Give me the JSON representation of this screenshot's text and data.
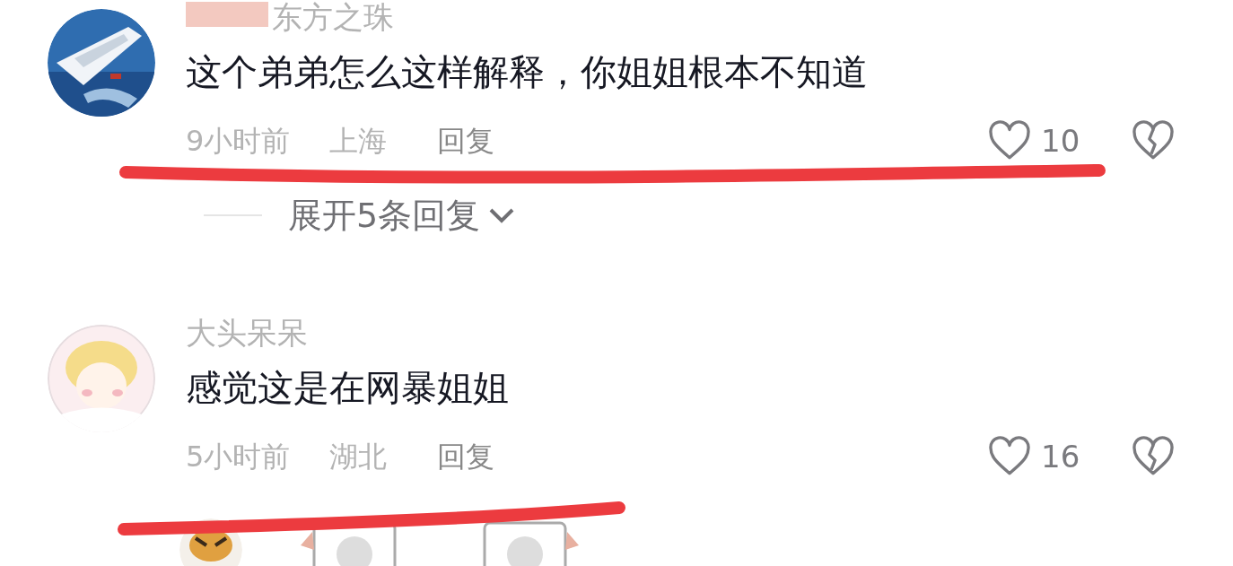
{
  "comments": [
    {
      "user": "东方之珠",
      "user_prefix_redacted": true,
      "text": "这个弟弟怎么这样解释，你姐姐根本不知道",
      "time": "9小时前",
      "region": "上海",
      "reply": "回复",
      "likes": "10",
      "expand": "展开5条回复"
    },
    {
      "user": "大头呆呆",
      "user_prefix_redacted": false,
      "text": "感觉这是在网暴姐姐",
      "time": "5小时前",
      "region": "湖北",
      "reply": "回复",
      "likes": "16"
    }
  ]
}
